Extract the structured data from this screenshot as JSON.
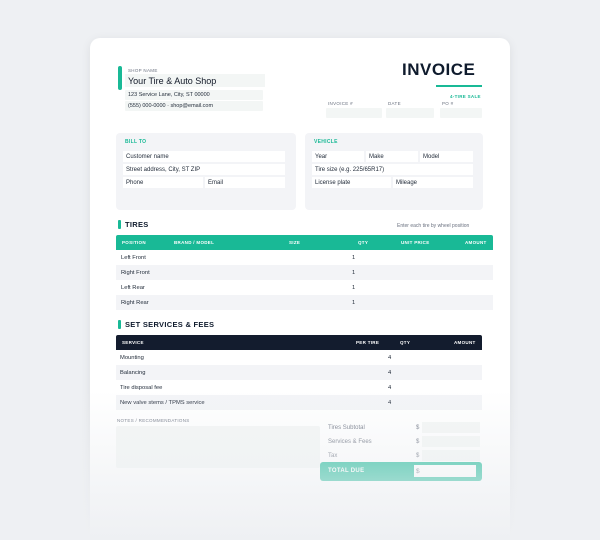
{
  "colors": {
    "accent": "#19b996",
    "dark": "#0f1b2d",
    "page_bg": "#eef0f3"
  },
  "shop": {
    "label": "SHOP NAME",
    "name": "Your Tire & Auto Shop",
    "address": "123 Service Lane, City, ST 00000",
    "contact": "(555) 000-0000 · shop@email.com"
  },
  "invoice": {
    "title": "INVOICE",
    "subtitle": "4-TIRE SALE",
    "fields": {
      "number_label": "INVOICE #",
      "date_label": "DATE",
      "po_label": "PO #"
    }
  },
  "bill_to": {
    "label": "BILL TO",
    "customer": "Customer name",
    "street": "Street address, City, ST ZIP",
    "phone": "Phone",
    "email": "Email"
  },
  "vehicle": {
    "label": "VEHICLE",
    "year": "Year",
    "make": "Make",
    "model": "Model",
    "tire_size": "Tire size (e.g. 225/65R17)",
    "plate": "License plate",
    "mileage": "Mileage"
  },
  "tires": {
    "title": "TIRES",
    "hint": "Enter each tire by wheel position",
    "headers": {
      "position": "POSITION",
      "brand": "BRAND / MODEL",
      "size": "SIZE",
      "qty": "QTY",
      "unit_price": "UNIT PRICE",
      "amount": "AMOUNT"
    },
    "rows": [
      {
        "position": "Left Front",
        "qty": "1"
      },
      {
        "position": "Right Front",
        "qty": "1"
      },
      {
        "position": "Left Rear",
        "qty": "1"
      },
      {
        "position": "Right Rear",
        "qty": "1"
      }
    ]
  },
  "services": {
    "title": "SET SERVICES & FEES",
    "headers": {
      "service": "SERVICE",
      "per_tire": "PER TIRE",
      "qty": "QTY",
      "amount": "AMOUNT"
    },
    "rows": [
      {
        "service": "Mounting",
        "qty": "4"
      },
      {
        "service": "Balancing",
        "qty": "4"
      },
      {
        "service": "Tire disposal fee",
        "qty": "4"
      },
      {
        "service": "New valve stems / TPMS service",
        "qty": "4"
      }
    ]
  },
  "notes": {
    "label": "NOTES / RECOMMENDATIONS"
  },
  "summary": {
    "currency": "$",
    "subtotal": "Tires Subtotal",
    "services": "Services & Fees",
    "tax": "Tax",
    "total": "TOTAL DUE"
  }
}
